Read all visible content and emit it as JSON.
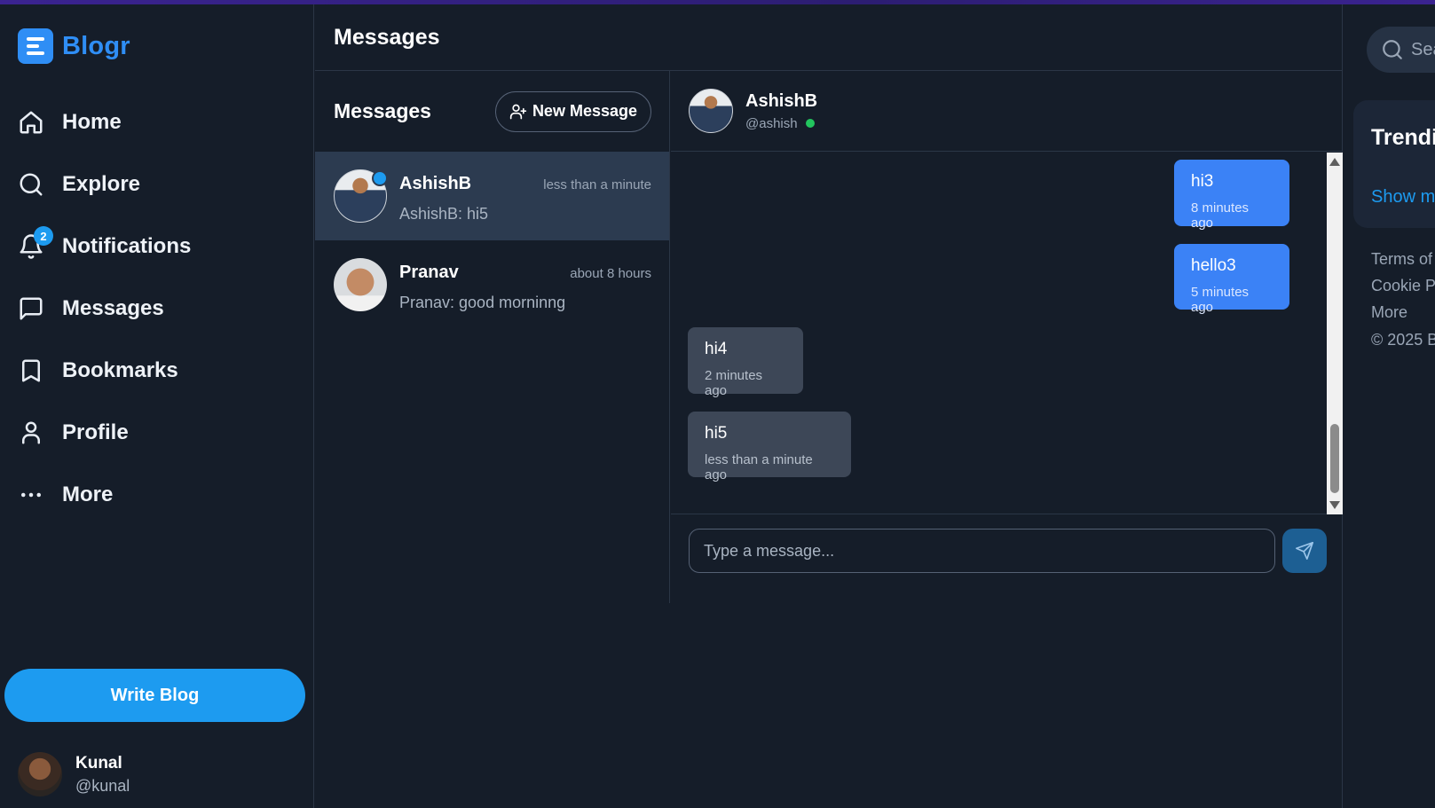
{
  "app": {
    "name": "Blogr"
  },
  "nav": {
    "items": [
      {
        "label": "Home",
        "icon": "home-icon"
      },
      {
        "label": "Explore",
        "icon": "search-icon"
      },
      {
        "label": "Notifications",
        "icon": "bell-icon",
        "badge": "2"
      },
      {
        "label": "Messages",
        "icon": "message-icon"
      },
      {
        "label": "Bookmarks",
        "icon": "bookmark-icon"
      },
      {
        "label": "Profile",
        "icon": "user-icon"
      },
      {
        "label": "More",
        "icon": "more-dots-icon"
      }
    ],
    "write_button": "Write Blog"
  },
  "current_user": {
    "name": "Kunal",
    "handle": "@kunal"
  },
  "main": {
    "title": "Messages"
  },
  "conversations": {
    "title": "Messages",
    "new_message_label": "New Message",
    "items": [
      {
        "name": "AshishB",
        "time": "less than a minute",
        "preview": "AshishB: hi5",
        "unread": true,
        "active": true
      },
      {
        "name": "Pranav",
        "time": "about 8 hours",
        "preview": "Pranav: good morninng",
        "unread": false,
        "active": false
      }
    ]
  },
  "chat": {
    "name": "AshishB",
    "handle": "@ashish",
    "online": true,
    "messages": [
      {
        "text": "hi3",
        "time": "8 minutes ago",
        "direction": "outgoing"
      },
      {
        "text": "hello3",
        "time": "5 minutes ago",
        "direction": "outgoing"
      },
      {
        "text": "hi4",
        "time": "2 minutes ago",
        "direction": "incoming"
      },
      {
        "text": "hi5",
        "time": "less than a minute ago",
        "direction": "incoming"
      }
    ],
    "input_placeholder": "Type a message..."
  },
  "right_sidebar": {
    "search_placeholder": "Sea",
    "trending_title": "Trendi",
    "show_more": "Show m",
    "footer_links": [
      "Terms of S",
      "Cookie Po",
      "More"
    ],
    "copyright": "© 2025 B"
  },
  "colors": {
    "background": "#151d29",
    "accent": "#1d9bf0",
    "brand": "#2f8ef5",
    "outgoing_bubble": "#3b82f6",
    "incoming_bubble": "#3d4757",
    "online": "#22c55e"
  }
}
